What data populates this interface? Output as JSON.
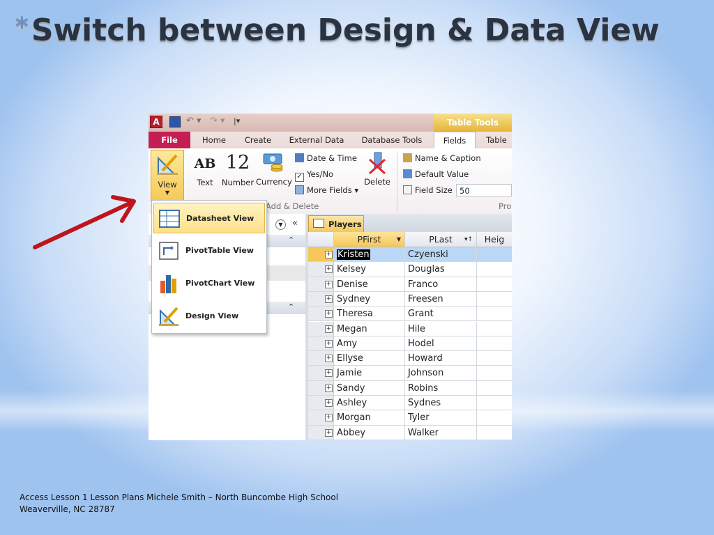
{
  "slide": {
    "title": "Switch between Design & Data View",
    "bullet": "*",
    "footer_line1": "Access Lesson 1 Lesson Plans Michele Smith – North Buncombe High School",
    "footer_line2": "Weaverville, NC  28787"
  },
  "app": {
    "table_tools": "Table Tools",
    "tabs": [
      "File",
      "Home",
      "Create",
      "External Data",
      "Database Tools",
      "Fields",
      "Table"
    ],
    "active_tab": "Fields",
    "ribbon": {
      "view": "View",
      "text": "Text",
      "ab": "AB",
      "number": "Number",
      "twelve": "12",
      "currency": "Currency",
      "date_time": "Date & Time",
      "yes_no": "Yes/No",
      "more_fields": "More Fields ▾",
      "delete": "Delete",
      "add_delete": "Add & Delete",
      "name_caption": "Name & Caption",
      "default_value": "Default Value",
      "field_size": "Field Size",
      "field_size_value": "50",
      "properties_partial": "Pro"
    },
    "view_menu": [
      {
        "label": "Datasheet View",
        "selected": true
      },
      {
        "label": "PivotTable View",
        "selected": false
      },
      {
        "label": "PivotChart View",
        "selected": false
      },
      {
        "label": "Design View",
        "selected": false
      }
    ],
    "datasheet": {
      "tab": "Players",
      "columns": [
        "PFirst",
        "PLast",
        "Heig"
      ],
      "rows": [
        [
          "Kristen",
          "Czyenski"
        ],
        [
          "Kelsey",
          "Douglas"
        ],
        [
          "Denise",
          "Franco"
        ],
        [
          "Sydney",
          "Freesen"
        ],
        [
          "Theresa",
          "Grant"
        ],
        [
          "Megan",
          "Hile"
        ],
        [
          "Amy",
          "Hodel"
        ],
        [
          "Ellyse",
          "Howard"
        ],
        [
          "Jamie",
          "Johnson"
        ],
        [
          "Sandy",
          "Robins"
        ],
        [
          "Ashley",
          "Sydnes"
        ],
        [
          "Morgan",
          "Tyler"
        ],
        [
          "Abbey",
          "Walker"
        ]
      ]
    }
  },
  "colors": {
    "file_tab": "#c41e52",
    "arrow": "#c0141c",
    "selected": "#f6c75a"
  }
}
